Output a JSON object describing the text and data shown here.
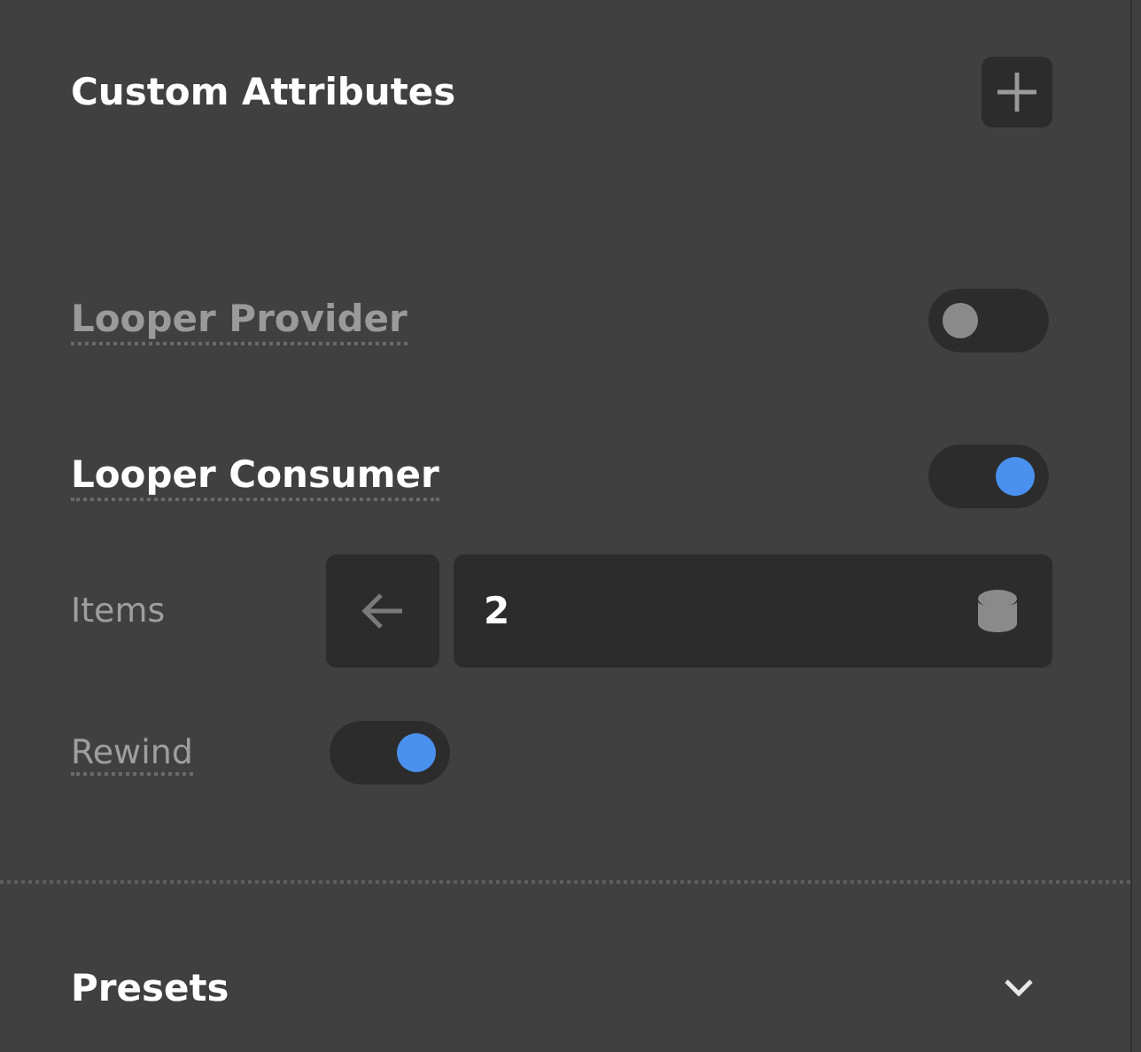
{
  "section": {
    "title": "Custom Attributes"
  },
  "attributes": [
    {
      "label": "Looper Provider",
      "on": false
    },
    {
      "label": "Looper Consumer",
      "on": true
    }
  ],
  "consumer_fields": [
    {
      "kind": "number",
      "label": "Items",
      "value": "2"
    },
    {
      "kind": "toggle",
      "label": "Rewind",
      "on": true
    }
  ],
  "presets": {
    "title": "Presets",
    "expanded": false
  }
}
